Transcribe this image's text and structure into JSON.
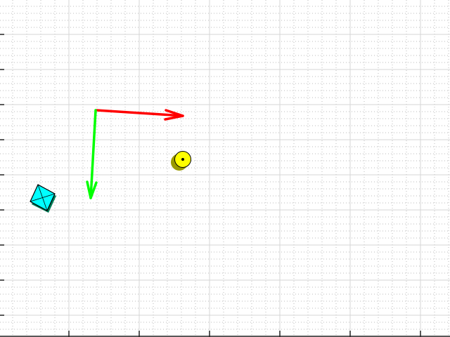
{
  "plot": {
    "background": "#ffffff",
    "grid": "on",
    "minor_grid": "on",
    "tick_labels": []
  },
  "objects": {
    "x_axis_arrow_color": "#ff0000",
    "y_axis_arrow_color": "#00ff00",
    "target_marker_color": "#ffff00",
    "target_marker_shadow_color": "#999900",
    "obstacle_color": "#00ffff",
    "obstacle_shadow_color": "#007a55"
  }
}
